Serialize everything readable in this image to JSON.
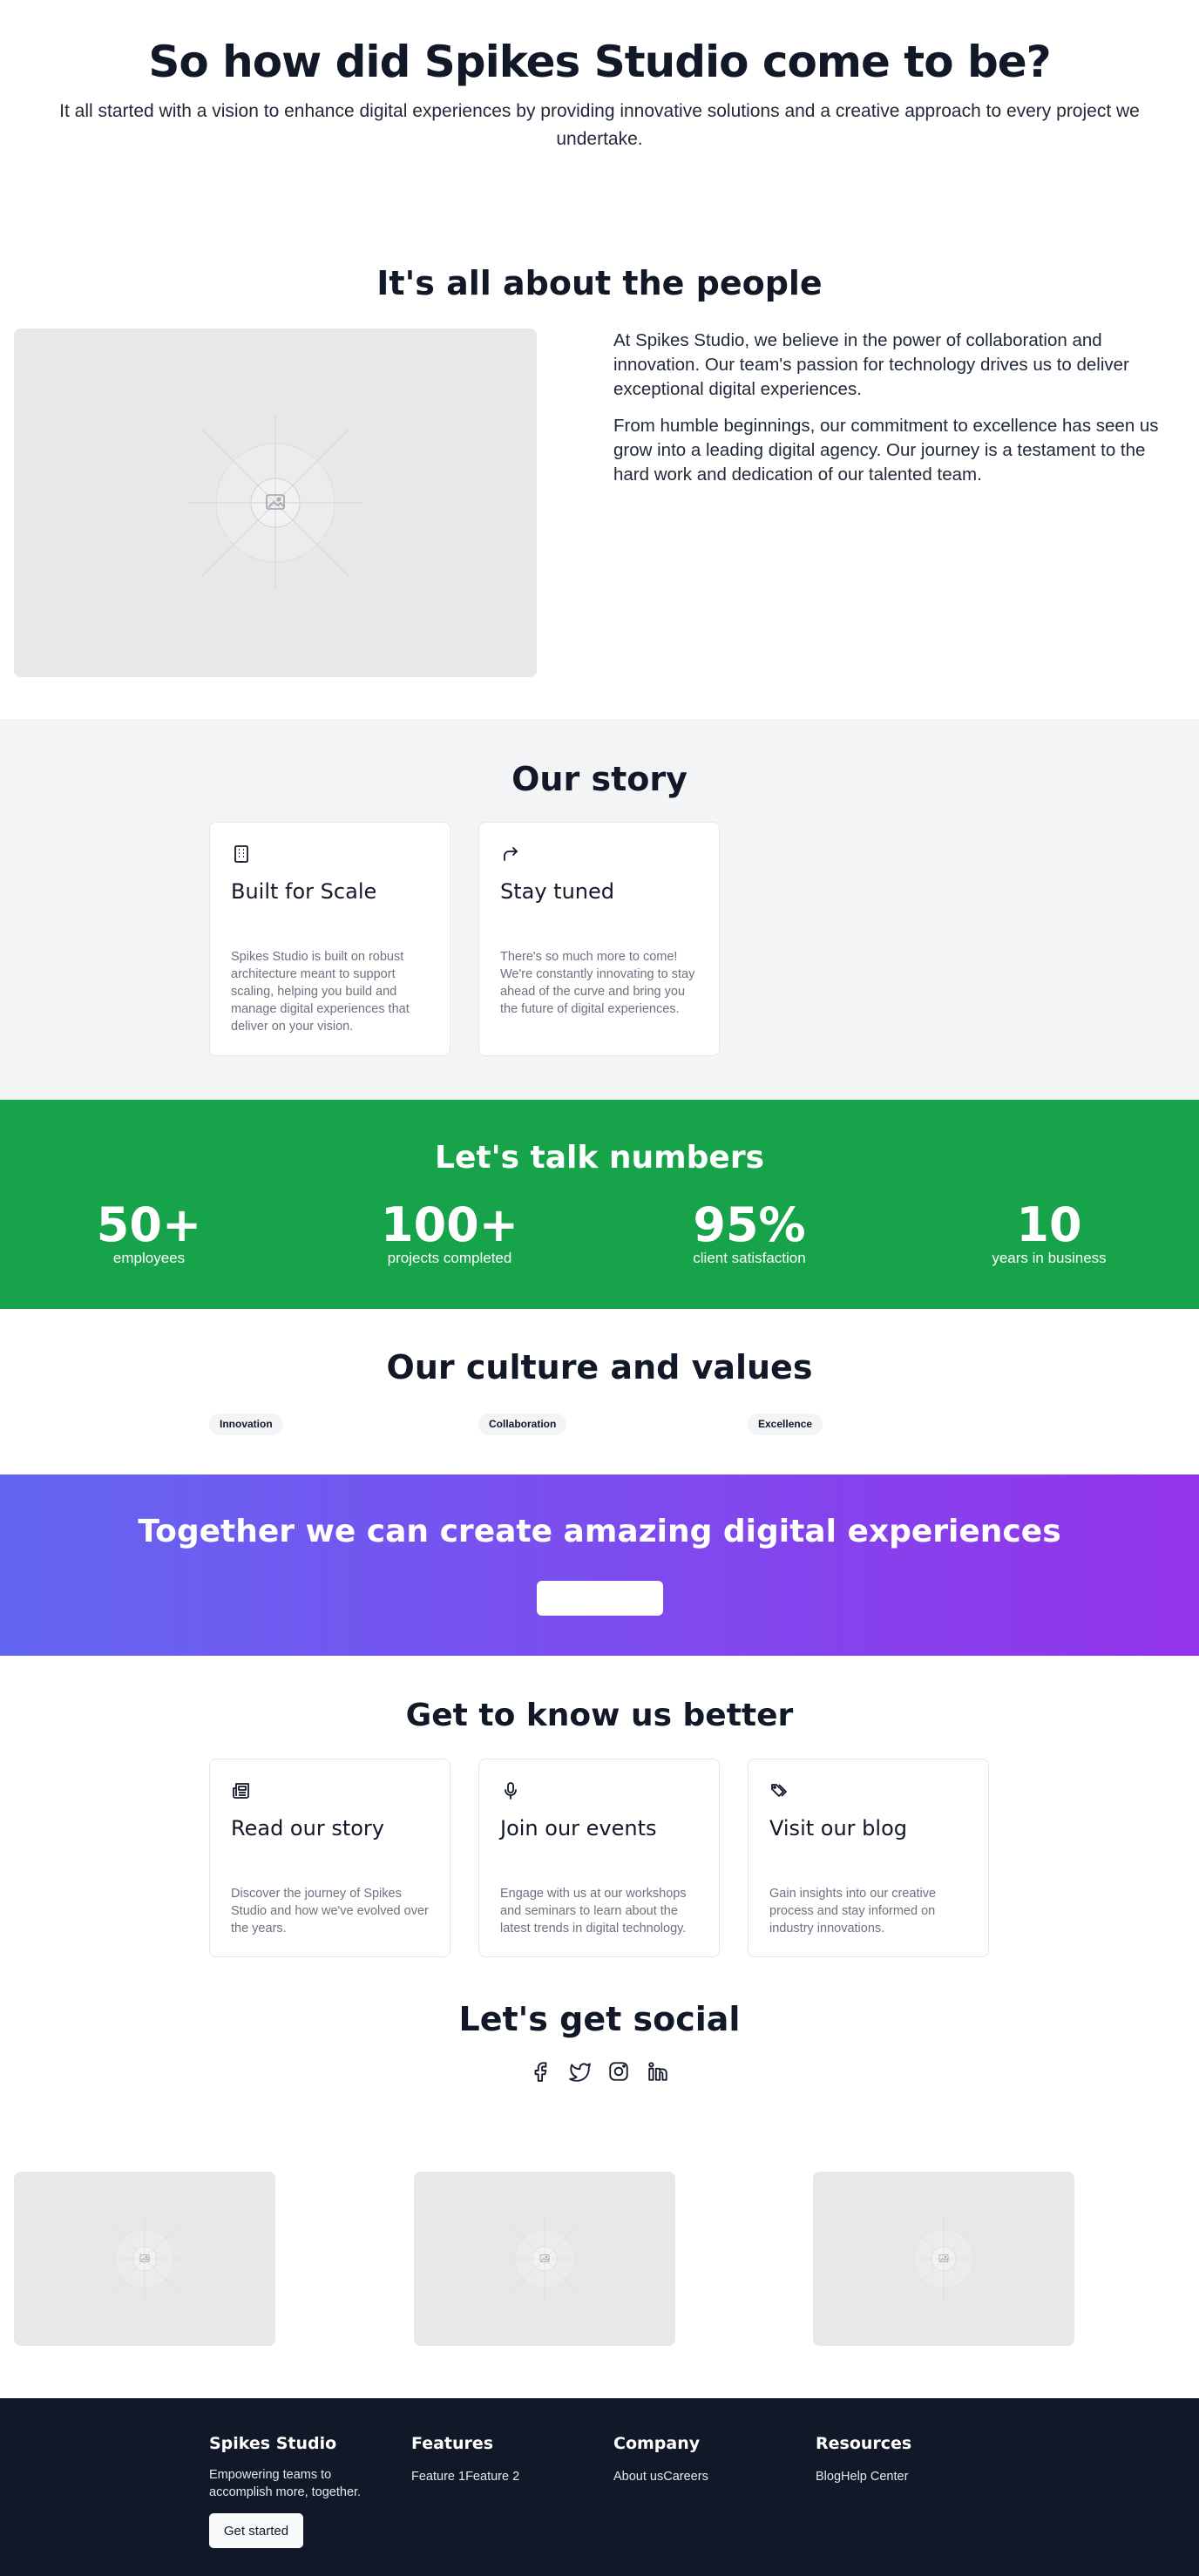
{
  "hero": {
    "title": "So how did Spikes Studio come to be?",
    "subtitle": "It all started with a vision to enhance digital experiences by providing innovative solutions and a creative approach to every project we undertake."
  },
  "people": {
    "title": "It's all about the people",
    "image_icon": "image-placeholder-icon",
    "paragraphs": [
      "At Spikes Studio, we believe in the power of collaboration and innovation. Our team's passion for technology drives us to deliver exceptional digital experiences.",
      "From humble beginnings, our commitment to excellence has seen us grow into a leading digital agency. Our journey is a testament to the hard work and dedication of our talented team."
    ]
  },
  "story": {
    "title": "Our story",
    "cards": [
      {
        "icon": "building-icon",
        "title": "Built for Scale",
        "text": "Spikes Studio is built on robust architecture meant to support scaling, helping you build and manage digital experiences that deliver on your vision."
      },
      {
        "icon": "share-arrow-icon",
        "title": "Stay tuned",
        "text": "There's so much more to come! We're constantly innovating to stay ahead of the curve and bring you the future of digital experiences."
      }
    ]
  },
  "numbers": {
    "title": "Let's talk numbers",
    "stats": [
      {
        "value": "50+",
        "label": "employees"
      },
      {
        "value": "100+",
        "label": "projects completed"
      },
      {
        "value": "95%",
        "label": "client satisfaction"
      },
      {
        "value": "10",
        "label": "years in business"
      }
    ]
  },
  "culture": {
    "title": "Our culture and values",
    "tags": [
      "Innovation",
      "Collaboration",
      "Excellence"
    ]
  },
  "cta": {
    "title": "Together we can create amazing digital experiences",
    "button_label": ""
  },
  "know": {
    "title": "Get to know us better",
    "cards": [
      {
        "icon": "newspaper-icon",
        "title": "Read our story",
        "text": "Discover the journey of Spikes Studio and how we've evolved over the years."
      },
      {
        "icon": "microphone-icon",
        "title": "Join our events",
        "text": "Engage with us at our workshops and seminars to learn about the latest trends in digital technology."
      },
      {
        "icon": "tags-icon",
        "title": "Visit our blog",
        "text": "Gain insights into our creative process and stay informed on industry innovations."
      }
    ]
  },
  "social": {
    "title": "Let's get social",
    "icons": [
      "facebook-icon",
      "twitter-icon",
      "instagram-icon",
      "linkedin-icon"
    ]
  },
  "footer": {
    "brand": "Spikes Studio",
    "tagline": "Empowering teams to accomplish more, together.",
    "cta_label": "Get started",
    "columns": [
      {
        "title": "Features",
        "links": [
          "Feature 1",
          "Feature 2"
        ]
      },
      {
        "title": "Company",
        "links": [
          "About us",
          "Careers"
        ]
      },
      {
        "title": "Resources",
        "links": [
          "Blog",
          "Help Center"
        ]
      }
    ]
  },
  "colors": {
    "green": "#16a34a",
    "footer_bg": "#111827",
    "gradient_start": "#6366f1",
    "gradient_end": "#9333ea",
    "story_bg": "#f3f4f6"
  }
}
